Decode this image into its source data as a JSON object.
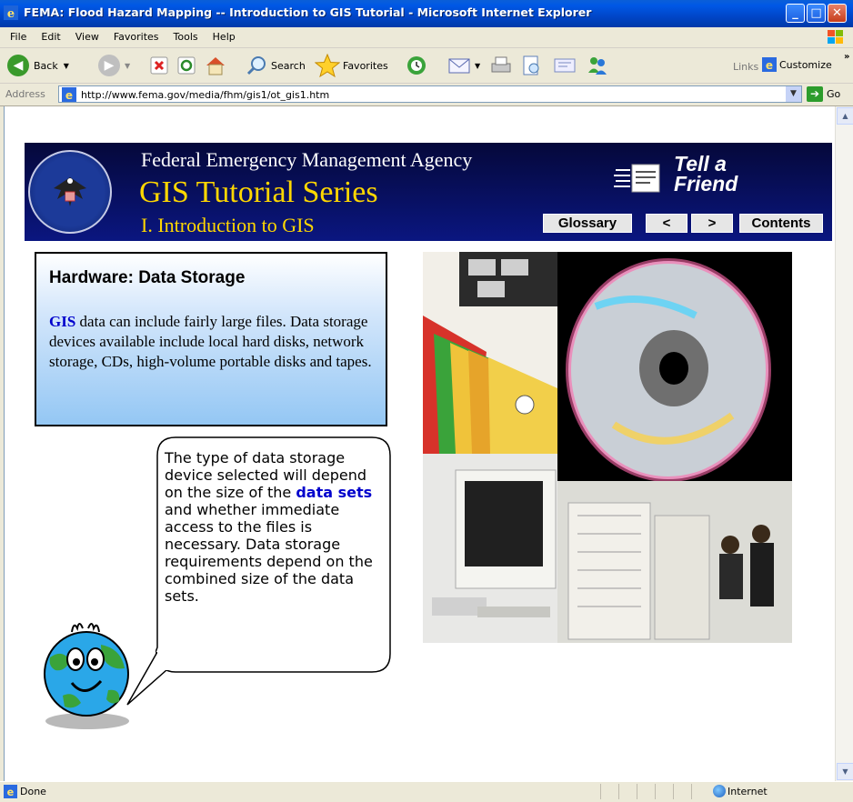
{
  "window": {
    "title": "FEMA: Flood Hazard Mapping -- Introduction to GIS Tutorial - Microsoft Internet Explorer"
  },
  "menu": [
    "File",
    "Edit",
    "View",
    "Favorites",
    "Tools",
    "Help"
  ],
  "toolbar": {
    "back": "Back",
    "search": "Search",
    "favorites": "Favorites",
    "links": "Links",
    "customize": "Customize"
  },
  "address": {
    "label": "Address",
    "url": "http://www.fema.gov/media/fhm/gis1/ot_gis1.htm",
    "go": "Go"
  },
  "banner": {
    "agency": "Federal Emergency Management Agency",
    "series": "GIS Tutorial Series",
    "subtitle": "I. Introduction to GIS",
    "tell_a": "Tell a",
    "friend": "Friend",
    "nav": {
      "glossary": "Glossary",
      "prev": "<",
      "next": ">",
      "contents": "Contents"
    }
  },
  "content": {
    "heading": "Hardware:  Data Storage",
    "gis_link": "GIS",
    "body": " data can include fairly large files. Data storage devices available include local hard disks, network storage, CDs, high-volume portable disks and tapes.",
    "bubble_pre": "The type of data storage device selected will depend on the size of the ",
    "bubble_link": "data sets",
    "bubble_post": " and whether immediate access to the files is necessary. Data storage requirements depend on the combined size of the data sets."
  },
  "status": {
    "text": "Done",
    "zone": "Internet"
  }
}
